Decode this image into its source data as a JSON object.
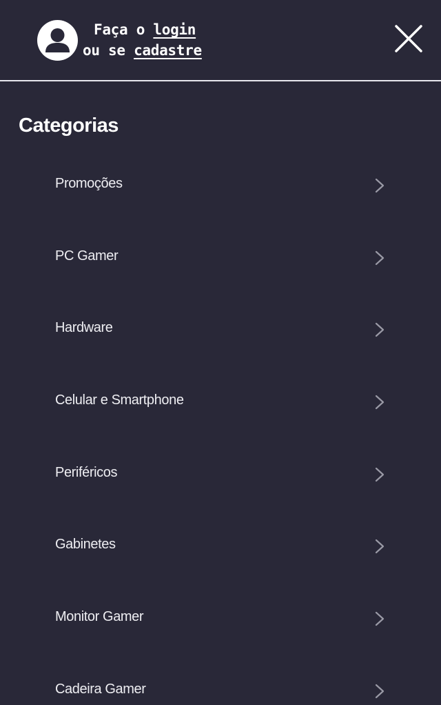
{
  "header": {
    "login_prompt_prefix": "Faça o",
    "login_link": "login",
    "signup_prompt_prefix": "ou se",
    "signup_link": "cadastre",
    "avatar_icon": "user-avatar-icon",
    "close_icon": "close-icon"
  },
  "categories": {
    "title": "Categorias",
    "items": [
      {
        "label": "Promoções"
      },
      {
        "label": "PC Gamer"
      },
      {
        "label": "Hardware"
      },
      {
        "label": "Celular e Smartphone"
      },
      {
        "label": "Periféricos"
      },
      {
        "label": "Gabinetes"
      },
      {
        "label": "Monitor Gamer"
      },
      {
        "label": "Cadeira Gamer"
      }
    ],
    "item_icon": "chevron-right-icon"
  },
  "colors": {
    "background": "#292838",
    "text": "#ffffff",
    "chevron": "#9a9aa6",
    "divider": "#e8e8ee"
  }
}
